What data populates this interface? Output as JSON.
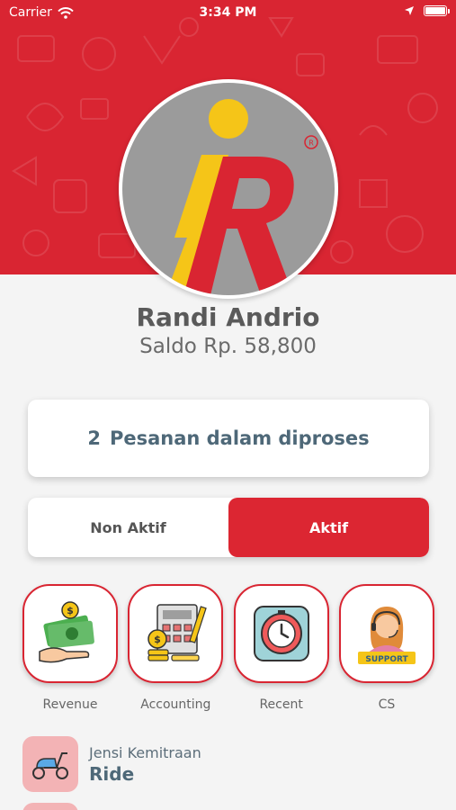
{
  "status_bar": {
    "carrier": "Carrier",
    "time": "3:34 PM"
  },
  "profile": {
    "name": "Randi Andrio",
    "balance": "Saldo Rp. 58,800"
  },
  "orders": {
    "count": "2",
    "text": "Pesanan dalam diproses"
  },
  "status_toggle": {
    "inactive_label": "Non Aktif",
    "active_label": "Aktif",
    "selected": "Aktif"
  },
  "menu": [
    {
      "label": "Revenue",
      "icon": "money-hand-icon"
    },
    {
      "label": "Accounting",
      "icon": "calculator-icon"
    },
    {
      "label": "Recent",
      "icon": "timer-icon"
    },
    {
      "label": "CS",
      "icon": "support-agent-icon"
    }
  ],
  "support_badge": "SUPPORT",
  "partnership": {
    "label": "Jensi Kemitraan",
    "value": "Ride",
    "icon": "scooter-icon"
  },
  "colors": {
    "brand_red": "#d92532",
    "logo_yellow": "#f5c518",
    "logo_gray": "#9b9b9b"
  }
}
